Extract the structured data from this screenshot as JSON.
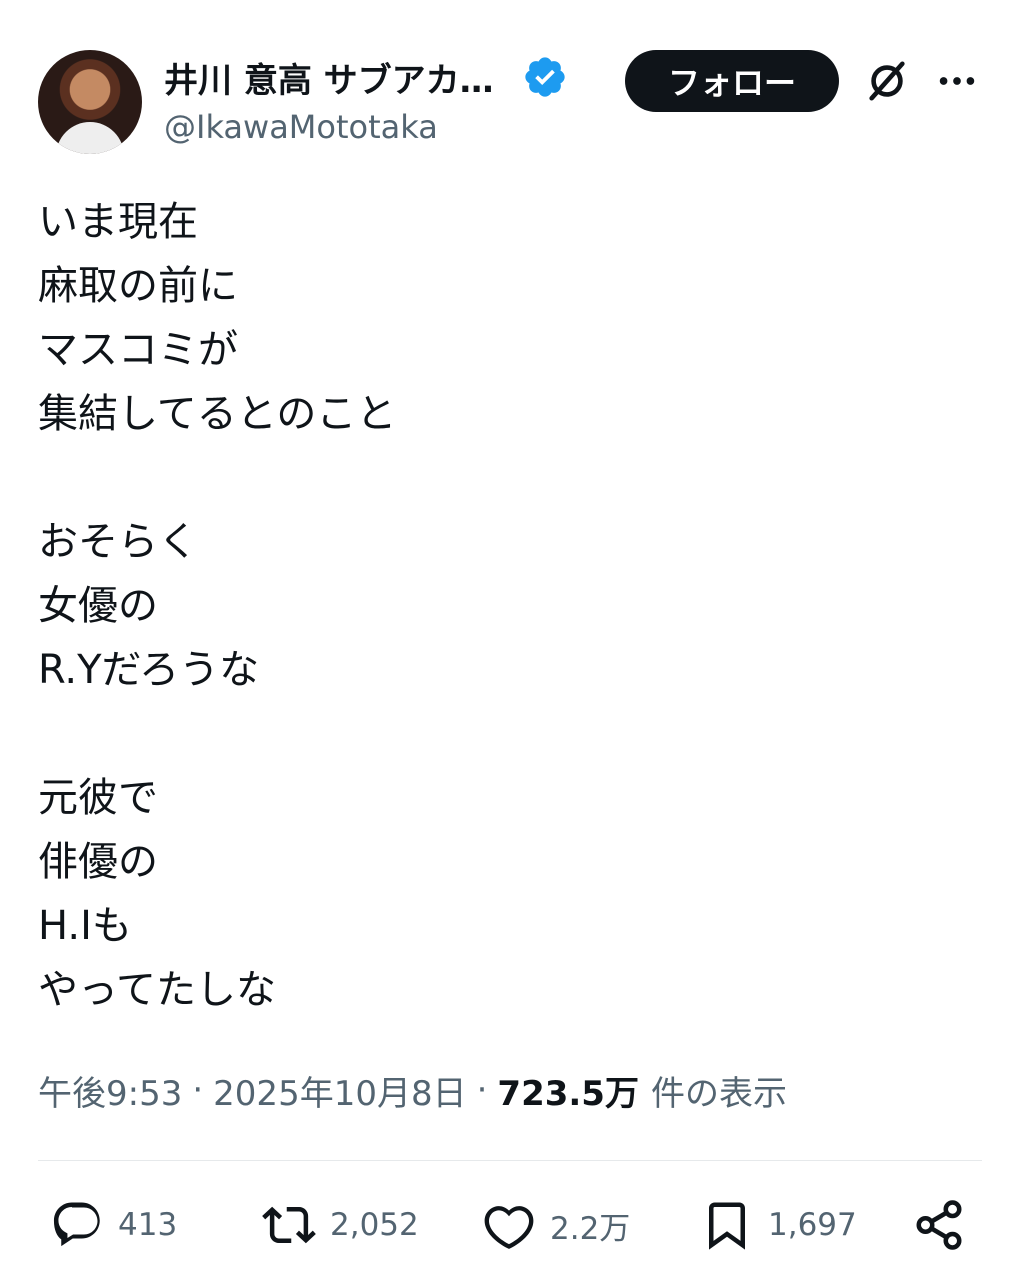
{
  "header": {
    "display_name": "井川 意高 サブアカ…",
    "handle": "@IkawaMototaka",
    "follow_label": "フォロー",
    "avatar_icon": "avatar-photo",
    "verified_icon": "verified-badge-icon",
    "grok_icon": "grok-icon",
    "more_icon": "more-options-icon"
  },
  "tweet": {
    "lines": [
      "いま現在",
      "麻取の前に",
      "マスコミが",
      "集結してるとのこと",
      "",
      "おそらく",
      "女優の",
      "R.Yだろうな",
      "",
      "元彼で",
      "俳優の",
      "H.Iも",
      "やってたしな"
    ]
  },
  "meta": {
    "time": "午後9:53",
    "date": "2025年10月8日",
    "views": "723.5万",
    "views_label": "件の表示",
    "separator": "·"
  },
  "actions": {
    "reply_count": "413",
    "retweet_count": "2,052",
    "like_count": "2.2万",
    "bookmark_count": "1,697"
  },
  "colors": {
    "text": "#0f1419",
    "secondary": "#536471",
    "verified": "#1d9bf0",
    "button_bg": "#0f1419",
    "divider": "#e6e9eb"
  }
}
